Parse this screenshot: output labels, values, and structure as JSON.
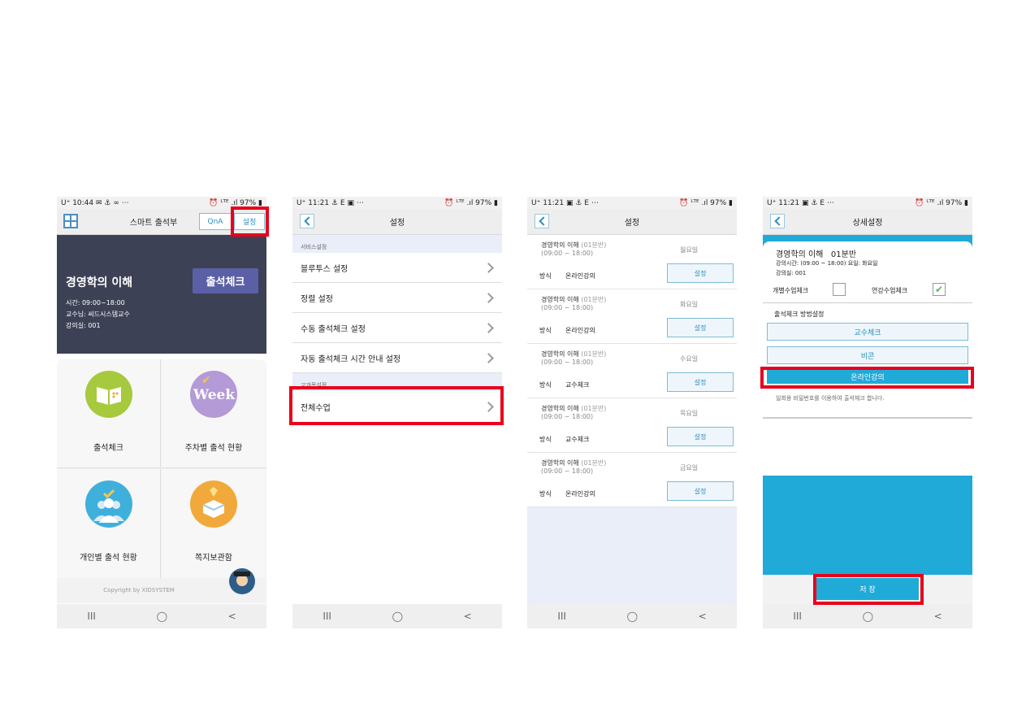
{
  "status": {
    "p1_left": "U⁺ 10:44 ✉ ⚓ ∞ ⋯",
    "p2_left": "U⁺ 11:21 ⚓ E ▣ ⋯",
    "p3_left": "U⁺ 11:21 ▣ ⚓ E ⋯",
    "p4_left": "U⁺ 11:21 ▣ ⚓ E ⋯",
    "right": "⏰ ᴸᵀᴱ .ıl 97% ▮"
  },
  "nav": {
    "recent": "III",
    "home": "◯",
    "back": "<"
  },
  "screen1": {
    "title": "스마트 출석부",
    "qna": "QnA",
    "settings": "설정",
    "course": "경영학의 이해",
    "check_btn": "출석체크",
    "time": "시간: 09:00~18:00",
    "professor": "교수님: 씨드시스템교수",
    "room": "강의실: 001",
    "tiles": [
      "출석체크",
      "주차별 출석 현황",
      "개인별 출석 현황",
      "쪽지보관함"
    ],
    "week_text": "Week",
    "copyright": "Copyright by XIDSYSTEM",
    "colors": {
      "book": "#a6c93e",
      "week": "#b49ad6",
      "people": "#3fb0dc",
      "box": "#f2a93b"
    }
  },
  "screen2": {
    "title": "설정",
    "section1": "서비스설정",
    "items": [
      "블루투스 설정",
      "정렬 설정",
      "수동 출석체크 설정",
      "자동 출석체크 시간 안내 설정"
    ],
    "section2": "교과목설정",
    "all_class": "전체수업"
  },
  "screen3": {
    "title": "설정",
    "method_label": "방식",
    "btn": "설정",
    "lectures": [
      {
        "name": "경영학의 이해",
        "section": "(01분반)",
        "time": "(09:00 ~ 18:00)",
        "day": "월요일",
        "method": "온라인강의"
      },
      {
        "name": "경영학의 이해",
        "section": "(01분반)",
        "time": "(09:00 ~ 18:00)",
        "day": "화요일",
        "method": "온라인강의"
      },
      {
        "name": "경영학의 이해",
        "section": "(01분반)",
        "time": "(09:00 ~ 18:00)",
        "day": "수요일",
        "method": "교수체크"
      },
      {
        "name": "경영학의 이해",
        "section": "(01분반)",
        "time": "(09:00 ~ 18:00)",
        "day": "목요일",
        "method": "교수체크"
      },
      {
        "name": "경영학의 이해",
        "section": "(01분반)",
        "time": "(09:00 ~ 18:00)",
        "day": "금요일",
        "method": "온라인강의"
      }
    ]
  },
  "screen4": {
    "title": "상세설정",
    "course": "경영학의 이해   01분반",
    "time_day": "강의시간: (09:00 ~ 18:00)  요일: 화요일",
    "room": "강의실: 001",
    "individual": "개별수업체크",
    "linked": "연강수업체크",
    "method_title": "출석체크 방법설정",
    "methods": [
      "교수체크",
      "비콘",
      "온라인강의"
    ],
    "desc": "일회용 비밀번호를 이용하여 출석체크 합니다.",
    "save": "저 장",
    "check_mark": "✔"
  }
}
